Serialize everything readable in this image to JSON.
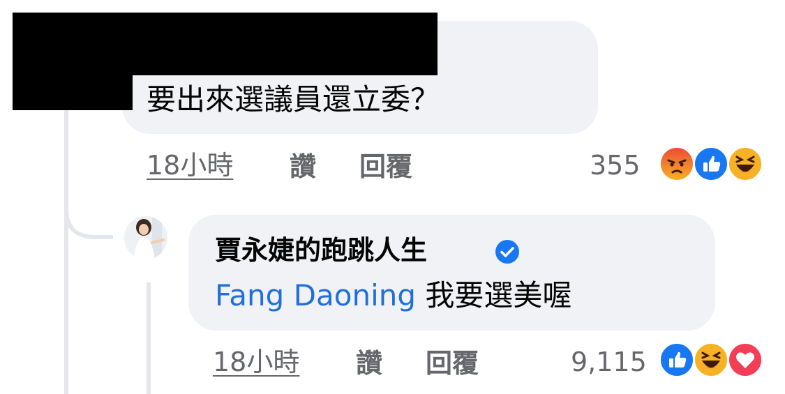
{
  "comment": {
    "text": "要出來選議員還立委？",
    "time": "18小時",
    "like_label": "讚",
    "reply_label": "回覆",
    "reaction_count": "355",
    "reactions": [
      "angry-icon",
      "like-icon",
      "haha-icon"
    ]
  },
  "reply": {
    "author": "賈永婕的跑跳人生",
    "verified_icon": "verified-badge-icon",
    "mention": "Fang Daoning",
    "text": "我要選美喔",
    "time": "18小時",
    "like_label": "讚",
    "reply_label": "回覆",
    "reaction_count": "9,115",
    "reactions": [
      "like-icon",
      "haha-icon",
      "love-icon"
    ]
  },
  "colors": {
    "bubble": "#f0f2f5",
    "meta_text": "#65676b",
    "mention": "#216fdb",
    "like": "#1877f2",
    "love": "#f33e58",
    "haha": "#f7b125",
    "angry": "#e9710f"
  }
}
